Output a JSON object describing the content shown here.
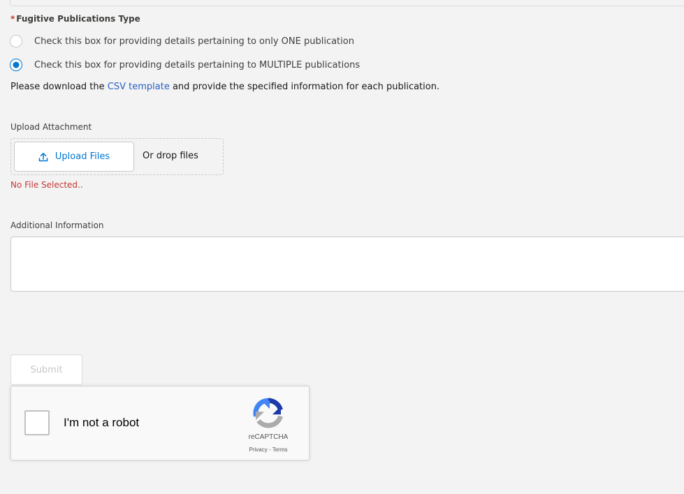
{
  "publication_type": {
    "required_marker": "*",
    "label": "Fugitive Publications Type",
    "options": [
      {
        "label": "Check this box for providing details pertaining to only ONE publication",
        "selected": false
      },
      {
        "label": "Check this box for providing details pertaining to MULTIPLE publications",
        "selected": true
      }
    ]
  },
  "download_note": {
    "prefix": "Please download the ",
    "link_text": "CSV template",
    "suffix": " and provide the specified information for each publication."
  },
  "upload": {
    "label": "Upload Attachment",
    "button_label": "Upload Files",
    "drop_text": "Or drop files",
    "status": "No File Selected.."
  },
  "additional_info": {
    "label": "Additional Information",
    "value": ""
  },
  "submit": {
    "label": "Submit",
    "disabled": true
  },
  "recaptcha": {
    "checkbox_label": "I'm not a robot",
    "brand": "reCAPTCHA",
    "privacy_link": "Privacy",
    "separator": " - ",
    "terms_link": "Terms"
  },
  "colors": {
    "accent": "#0176d3",
    "error": "#c23934",
    "link": "#2b5fc4"
  }
}
